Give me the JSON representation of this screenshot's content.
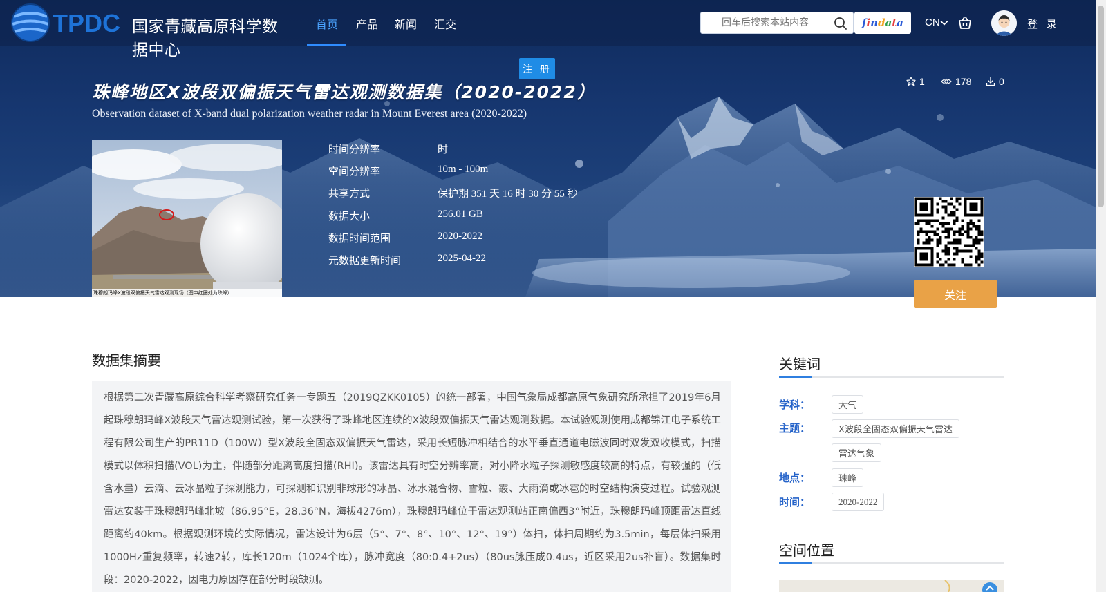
{
  "brand": {
    "logo_text": "国家青藏高原科学数据中心",
    "logo_abbr": "TPDC"
  },
  "nav": {
    "items": [
      "首页",
      "产品",
      "新闻",
      "汇交"
    ],
    "active_index": 0
  },
  "search": {
    "placeholder": "回车后搜索本站内容"
  },
  "findata": {
    "label": "findata"
  },
  "lang": {
    "label": "CN"
  },
  "user": {
    "login_label": "登 录"
  },
  "register": {
    "label": "注 册"
  },
  "dataset": {
    "title_cn": "珠峰地区X波段双偏振天气雷达观测数据集（2020-2022）",
    "title_en": "Observation dataset of X-band dual polarization weather radar in Mount Everest area (2020-2022)",
    "stars": "1",
    "views": "178",
    "downloads": "0",
    "thumb_caption": "珠穆朗玛峰X波段双偏振天气雷达观测现场（图中红圈处为珠峰）",
    "meta": [
      {
        "key": "时间分辨率",
        "value": "时"
      },
      {
        "key": "空间分辨率",
        "value": "10m - 100m"
      },
      {
        "key": "共享方式",
        "value": "保护期 351 天 16 时 30 分 55 秒"
      },
      {
        "key": "数据大小",
        "value": "256.01 GB"
      },
      {
        "key": "数据时间范围",
        "value": "2020-2022"
      },
      {
        "key": "元数据更新时间",
        "value": "2025-04-22"
      }
    ],
    "follow_label": "关注"
  },
  "abstract": {
    "title": "数据集摘要",
    "text": "根据第二次青藏高原综合科学考察研究任务一专题五（2019QZKK0105）的统一部署，中国气象局成都高原气象研究所承担了2019年6月起珠穆朗玛峰X波段天气雷达观测试验，第一次获得了珠峰地区连续的X波段双偏振天气雷达观测数据。本试验观测使用成都锦江电子系统工程有限公司生产的PR11D（100W）型X波段全固态双偏振天气雷达，采用长短脉冲相结合的水平垂直通道电磁波同时双发双收模式，扫描模式以体积扫描(VOL)为主，伴随部分距离高度扫描(RHI)。该雷达具有时空分辨率高，对小降水粒子探测敏感度较高的特点，有较强的（低含水量）云滴、云冰晶粒子探测能力，可探测和识别非球形的冰晶、冰水混合物、雪粒、霰、大雨滴或冰雹的时空结构演变过程。试验观测雷达安装于珠穆朗玛峰北坡（86.95°E，28.36°N，海拔4276m），珠穆朗玛峰位于雷达观测站正南偏西3°附近，珠穆朗玛峰顶距雷达直线距离约40km。根据观测环境的实际情况，雷达设计为6层（5°、7°、8°、10°、12°、19°）体扫，体扫周期约为3.5min，每层体扫采用1000Hz重复频率，转速2转，库长120m（1024个库），脉冲宽度（80:0.4+2us）（80us脉压成0.4us，近区采用2us补盲）。数据集时段：2020-2022，因电力原因存在部分时段缺测。"
  },
  "keywords": {
    "title": "关键词",
    "groups": [
      {
        "label": "学科：",
        "tags": [
          "大气"
        ]
      },
      {
        "label": "主题：",
        "tags": [
          "X波段全固态双偏振天气雷达",
          "雷达气象"
        ]
      },
      {
        "label": "地点：",
        "tags": [
          "珠峰"
        ]
      },
      {
        "label": "时间：",
        "tags": [
          "2020-2022"
        ]
      }
    ]
  },
  "location": {
    "title": "空间位置"
  },
  "colors": {
    "accent": "#2f8cff",
    "follow": "#e9a247",
    "register": "#1f8ce6",
    "keyword_label": "#2563c9"
  }
}
